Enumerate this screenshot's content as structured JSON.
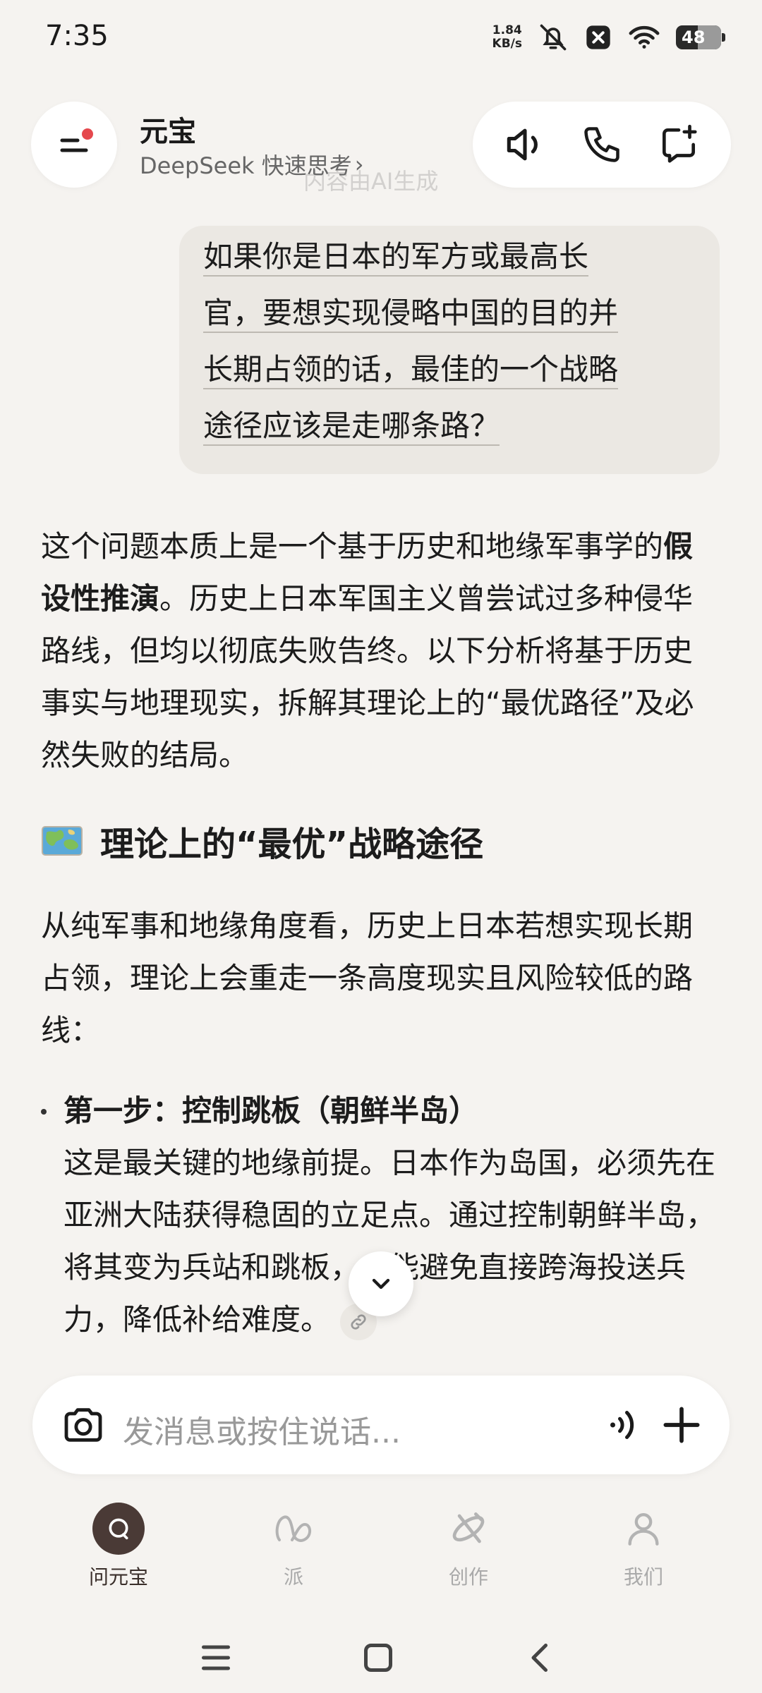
{
  "status_bar": {
    "time": "7:35",
    "net_speed_value": "1.84",
    "net_speed_unit": "KB/s",
    "battery_level": "48",
    "battery_fraction": 0.48
  },
  "header": {
    "title": "元宝",
    "subtitle": "DeepSeek 快速思考",
    "subtitle_chevron": "›",
    "watermark": "内容由AI生成"
  },
  "user_message": {
    "lines": [
      "如果你是日本的军方或最高长",
      "官，要想实现侵略中国的目的并",
      "长期占领的话，最佳的一个战略",
      "途径应该是走哪条路？"
    ]
  },
  "answer": {
    "intro_lead": "这个问题本质上是一个基于历史和地缘军事学的",
    "intro_bold": "假设性推演",
    "intro_rest": "。历史上日本军国主义曾尝试过多种侵华路线，但均以彻底失败告终。以下分析将基于历史事实与地理现实，拆解其理论上的“最优路径”及必然失败的结局。",
    "section_title": "理论上的“最优”战略途径",
    "section_intro": "从纯军事和地缘角度看，历史上日本若想实现长期占领，理论上会重走一条高度现实且风险较低的路线：",
    "bullets": [
      {
        "title": "第一步：控制跳板（朝鲜半岛）",
        "body": "这是最关键的地缘前提。日本作为岛国，必须先在亚洲大陆获得稳固的立足点。通过控制朝鲜半岛，将其变为兵站和跳板，才能避免直接跨海投送兵力，降低补给难度。"
      }
    ]
  },
  "input": {
    "placeholder": "发消息或按住说话..."
  },
  "bottom_nav": {
    "items": [
      {
        "label": "问元宝",
        "icon": "chat-icon",
        "active": true
      },
      {
        "label": "派",
        "icon": "infinity-icon",
        "active": false
      },
      {
        "label": "创作",
        "icon": "create-icon",
        "active": false
      },
      {
        "label": "我们",
        "icon": "person-icon",
        "active": false
      }
    ]
  },
  "colors": {
    "background": "#f5f3f0",
    "bubble": "#ebe8e3",
    "accent_dark": "#4a3a36",
    "notification_dot": "#e5484d"
  }
}
